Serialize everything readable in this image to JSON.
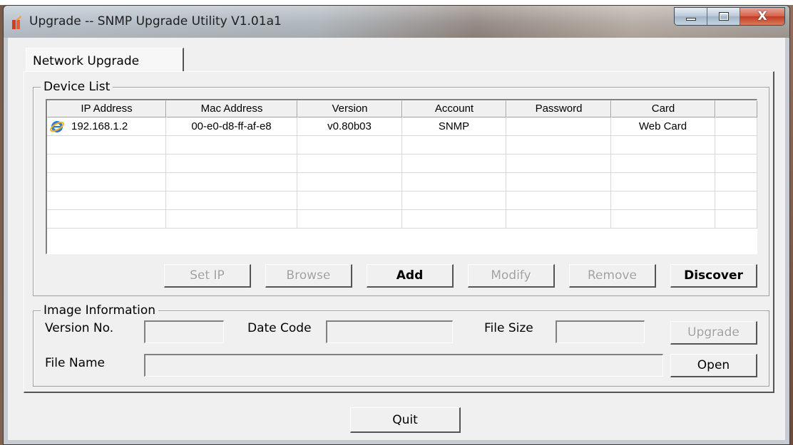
{
  "window": {
    "title": "Upgrade -- SNMP Upgrade Utility V1.01a1",
    "close_glyph": "X"
  },
  "tabs": [
    {
      "label": "Network Upgrade",
      "active": true
    }
  ],
  "device_list": {
    "title": "Device List",
    "columns": [
      "IP Address",
      "Mac Address",
      "Version",
      "Account",
      "Password",
      "Card",
      ""
    ],
    "rows": [
      {
        "ip": "192.168.1.2",
        "mac": "00-e0-d8-ff-af-e8",
        "version": "v0.80b03",
        "account": "SNMP",
        "password": "",
        "card": "Web Card",
        "icon": "internet-explorer-icon"
      }
    ],
    "buttons": {
      "set_ip": "Set IP",
      "browse": "Browse",
      "add": "Add",
      "modify": "Modify",
      "remove": "Remove",
      "discover": "Discover"
    }
  },
  "image_info": {
    "title": "Image Information",
    "version_label": "Version No.",
    "version_value": "",
    "date_label": "Date Code",
    "date_value": "",
    "size_label": "File Size",
    "size_value": "",
    "upgrade_label": "Upgrade",
    "file_name_label": "File Name",
    "file_name_value": "",
    "open_label": "Open"
  },
  "footer": {
    "quit_label": "Quit"
  }
}
